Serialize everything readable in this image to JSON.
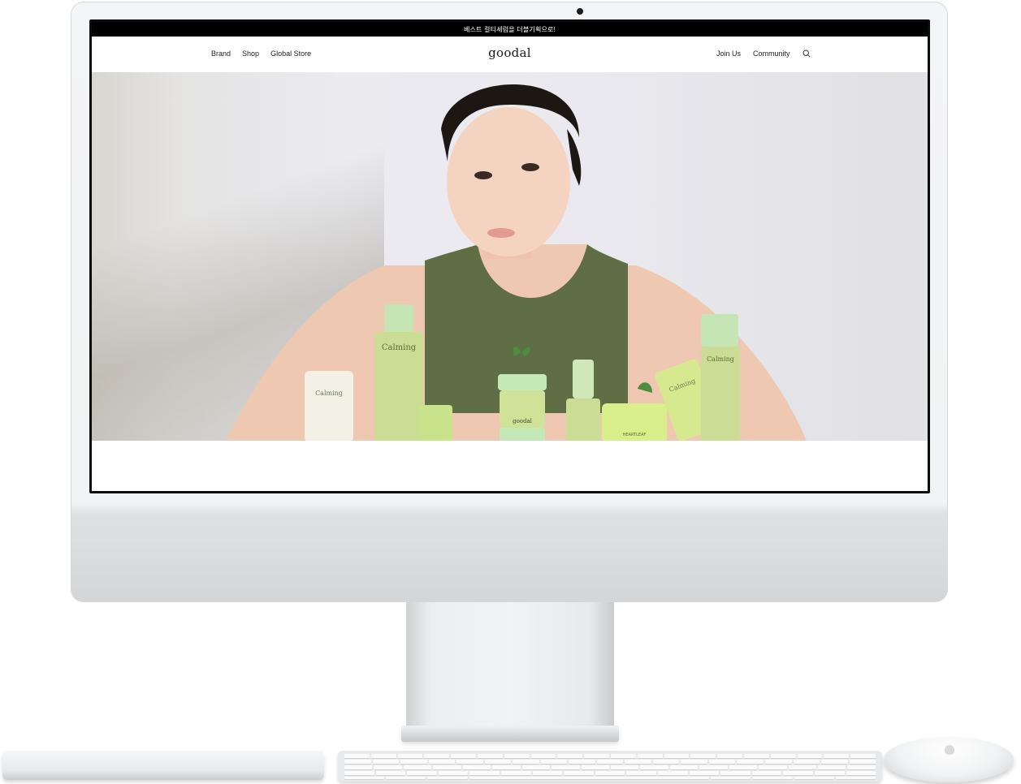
{
  "announcement": {
    "text": "베스트 컬티세럼을 더블기획으로!"
  },
  "header": {
    "logo_text": "goodal",
    "nav_left": [
      "Brand",
      "Shop",
      "Global Store"
    ],
    "nav_right": [
      "Join Us",
      "Community"
    ],
    "search_icon": "search-icon"
  },
  "hero": {
    "product_labels": {
      "brand": "HEARTLEAF",
      "line": "Calming",
      "small_brand": "goodal"
    }
  },
  "colors": {
    "announcement_bg": "#000000",
    "product_green": "#c7dd8e",
    "product_mint": "#bfe3b5",
    "tank_top": "#5f6e45"
  }
}
